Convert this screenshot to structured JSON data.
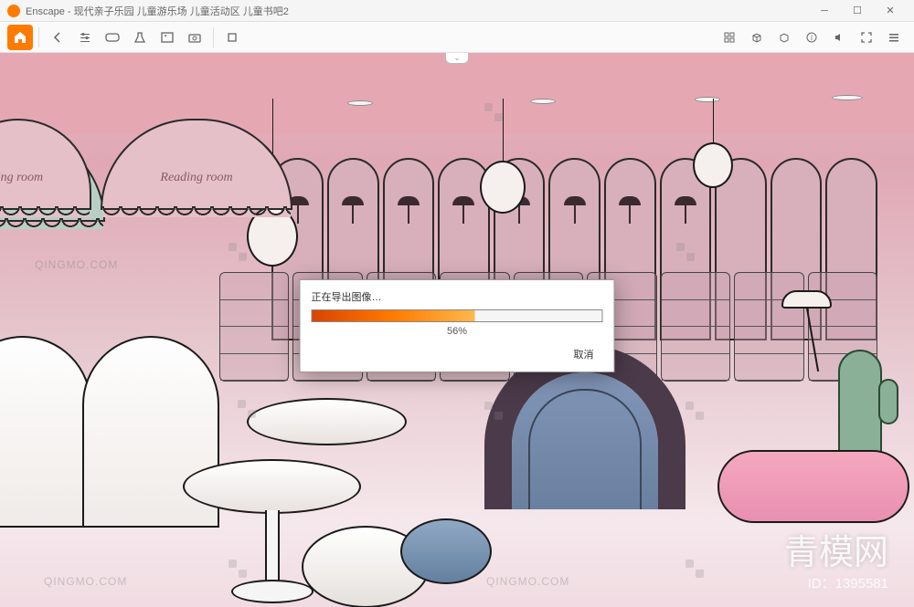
{
  "window": {
    "app_name": "Enscape",
    "title_separator": " - ",
    "document_title": "现代亲子乐园 儿童游乐场 儿童活动区 儿童书吧2"
  },
  "toolbar": {
    "home_icon": "home",
    "icons_left": [
      "back",
      "settings",
      "3d",
      "media",
      "effects",
      "camera",
      "render"
    ],
    "icons_right": [
      "grid",
      "view-ortho",
      "view-persp",
      "info",
      "sound",
      "expand",
      "menu"
    ]
  },
  "progress": {
    "title": "正在导出图像…",
    "percent_value": 56,
    "percent_label": "56%",
    "cancel_label": "取消"
  },
  "scene": {
    "awning_text_left": "ling room",
    "awning_text_right": "Reading room"
  },
  "watermark": {
    "domain": "QINGMO.COM",
    "brand": "青模网",
    "id_label": "ID：1395581"
  }
}
